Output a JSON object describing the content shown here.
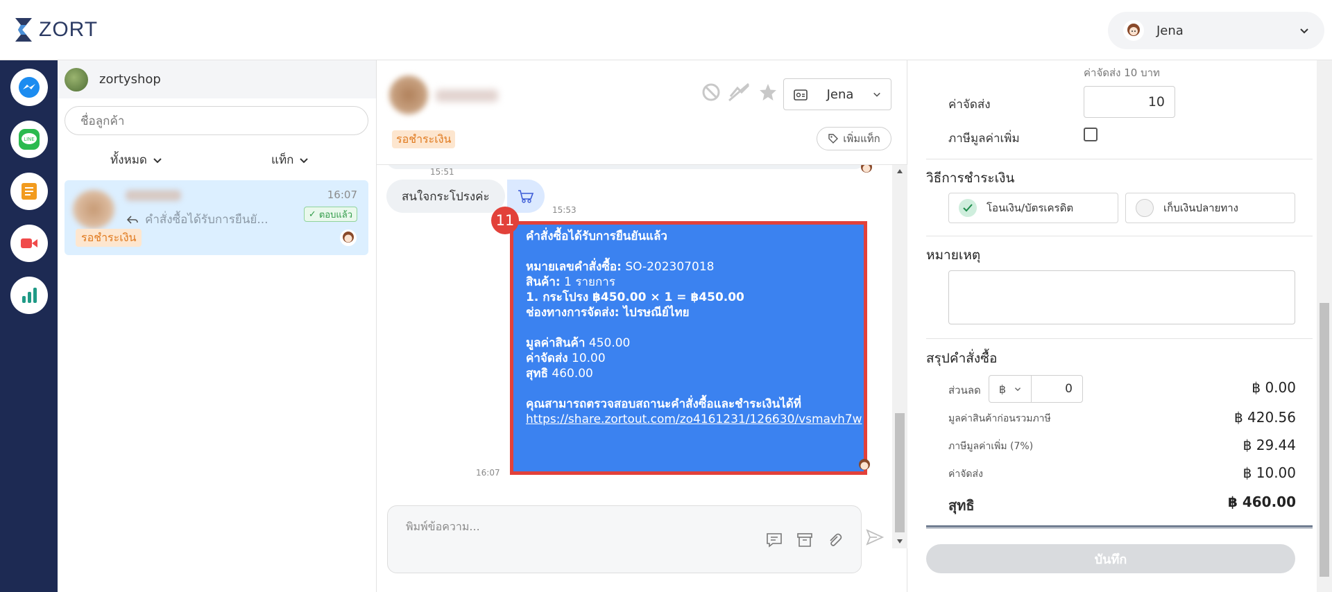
{
  "app": {
    "logo_text": "ZORT"
  },
  "user": {
    "name": "Jena"
  },
  "rail": {
    "items": [
      "messenger",
      "line",
      "orders",
      "live",
      "analytics"
    ]
  },
  "customer_list": {
    "shop_name": "zortyshop",
    "search_placeholder": "ชื่อลูกค้า",
    "filter_all": "ทั้งหมด",
    "filter_tag": "แท็ก",
    "conversation": {
      "last_message": "คำสั่งซื้อได้รับการยืนยั...",
      "time": "16:07",
      "replied_badge": "ตอบแล้ว",
      "status": "รอชำระเงิน"
    }
  },
  "chat": {
    "assignee": "Jena",
    "status_tag": "รอชำระเงิน",
    "add_tag": "เพิ่มแท็ก",
    "time_1": "15:51",
    "incoming_message": "สนใจกระโปรงค่ะ",
    "time_2": "15:53",
    "step_badge": "11",
    "order_message": {
      "title": "คำสั่งซื้อได้รับการยืนยันแล้ว",
      "order_no_label": "หมายเลขคำสั่งซื้อ:",
      "order_no": " SO-202307018",
      "items_label": "สินค้า:",
      "items": " 1 รายการ",
      "item_line": "1. กระโปรง ฿450.00 × 1 = ฿450.00",
      "shipping_channel_label": "ช่องทางการจัดส่ง:",
      "shipping_channel": " ไปรษณีย์ไทย",
      "value_label": "มูลค่าสินค้า",
      "value": " 450.00",
      "shipping_label": "ค่าจัดส่ง",
      "shipping": " 10.00",
      "net_label": "สุทธิ",
      "net": " 460.00",
      "check_text": "คุณสามารถตรวจสอบสถานะคำสั่งซื้อและชำระเงินได้ที่",
      "link": "https://share.zortout.com/zo4161231/126630/vsmavh7w"
    },
    "time_3": "16:07",
    "composer_placeholder": "พิมพ์ข้อความ..."
  },
  "order_panel": {
    "shipping_hint": "ค่าจัดส่ง 10 บาท",
    "shipping_label": "ค่าจัดส่ง",
    "shipping_value": "10",
    "vat_label": "ภาษีมูลค่าเพิ่ม",
    "payment_title": "วิธีการชำระเงิน",
    "pay_transfer": "โอนเงิน/บัตรเครดิต",
    "pay_cod": "เก็บเงินปลายทาง",
    "note_title": "หมายเหตุ",
    "summary_title": "สรุปคำสั่งซื้อ",
    "discount_label": "ส่วนลด",
    "discount_currency": "฿",
    "discount_value": "0",
    "discount_amount": "฿ 0.00",
    "pre_tax_label": "มูลค่าสินค้าก่อนรวมภาษี",
    "pre_tax_amount": "฿ 420.56",
    "vat_line_label": "ภาษีมูลค่าเพิ่ม (7%)",
    "vat_amount": "฿ 29.44",
    "shipping_line_label": "ค่าจัดส่ง",
    "shipping_amount": "฿ 10.00",
    "net_label": "สุทธิ",
    "net_amount": "฿ 460.00",
    "save_label": "บันทึก"
  },
  "colors": {
    "rail": "#1d2a53",
    "bubble_out": "#3b82f0",
    "highlight": "#e2413a",
    "status_orange": "#e07a1f"
  }
}
